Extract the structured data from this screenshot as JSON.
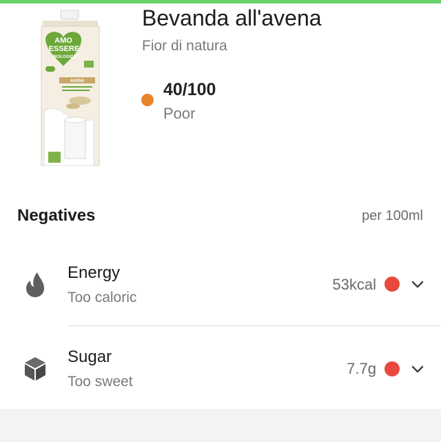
{
  "colors": {
    "accent_bar": "#6ad26a",
    "score_poor": "#e6852a",
    "negative_red": "#e8483e",
    "icon_gray": "#5f5f5f"
  },
  "product": {
    "title": "Bevanda all'avena",
    "brand": "Fior di natura",
    "image_icon": "oat-milk-carton-image",
    "packaging": {
      "brand_line_1": "AMO",
      "brand_line_2": "ESSERE",
      "brand_line_3": "BIOLOGICO",
      "variety": "AVENA"
    }
  },
  "score": {
    "value": "40/100",
    "label": "Poor",
    "dot_color": "#e6852a"
  },
  "negatives": {
    "title": "Negatives",
    "unit": "per 100ml",
    "items": [
      {
        "name": "Energy",
        "description": "Too caloric",
        "value": "53kcal",
        "icon": "energy-flame-icon",
        "dot_color": "#e8483e"
      },
      {
        "name": "Sugar",
        "description": "Too sweet",
        "value": "7.7g",
        "icon": "sugar-cube-icon",
        "dot_color": "#e8483e"
      }
    ]
  }
}
